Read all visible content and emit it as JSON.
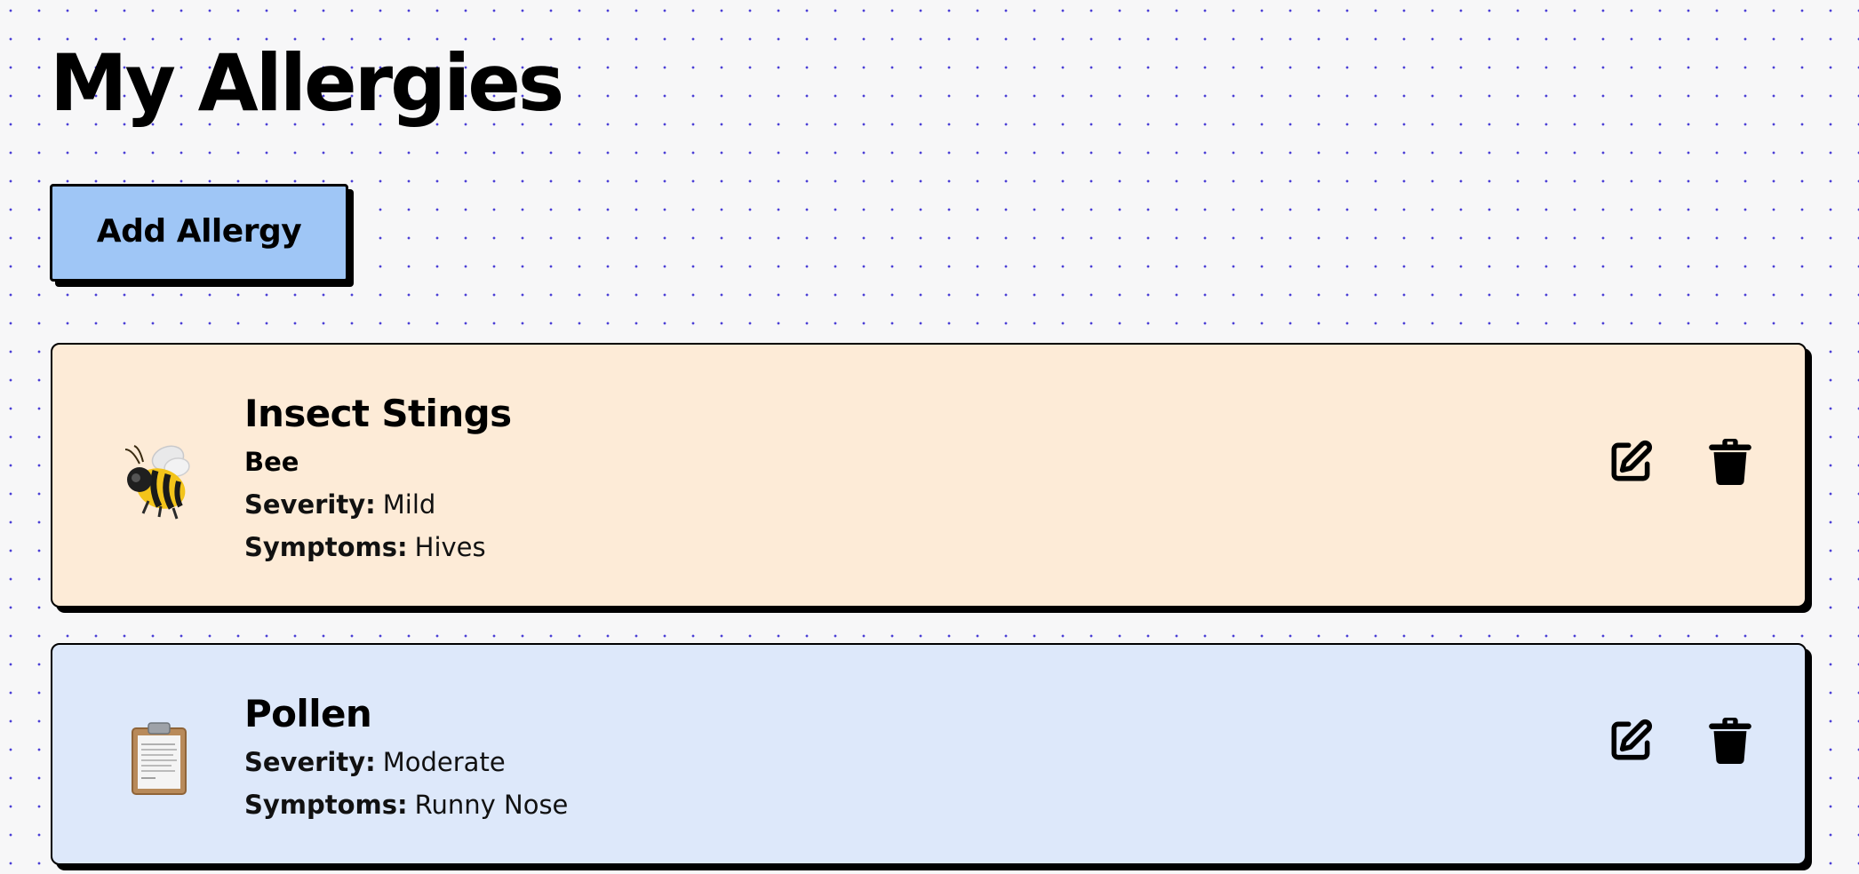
{
  "page": {
    "title": "My Allergies"
  },
  "toolbar": {
    "add_label": "Add Allergy"
  },
  "allergies": [
    {
      "title": "Insect Stings",
      "subtitle": "Bee",
      "icon": "bee-icon",
      "background": "#fdebd7",
      "severity_label": "Severity:",
      "severity": "Mild",
      "symptoms_label": "Symptoms:",
      "symptoms": "Hives"
    },
    {
      "title": "Pollen",
      "icon": "clipboard-icon",
      "background": "#dde8fa",
      "severity_label": "Severity:",
      "severity": "Moderate",
      "symptoms_label": "Symptoms:",
      "symptoms": "Runny Nose"
    }
  ],
  "actions": {
    "edit_icon": "edit-icon",
    "delete_icon": "trash-icon"
  },
  "colors": {
    "add_button": "#9fc6f6",
    "dot_grid": "#4b3fd6",
    "page_background": "#f7f7f8"
  }
}
